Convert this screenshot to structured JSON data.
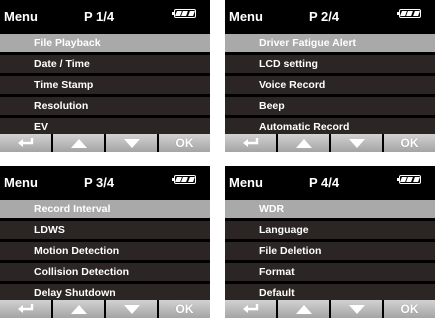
{
  "panels": [
    {
      "menu_title": "Menu",
      "page": "P 1/4",
      "items": [
        "File Playback",
        "Date / Time",
        "Time Stamp",
        "Resolution",
        "EV"
      ],
      "selected_index": 0
    },
    {
      "menu_title": "Menu",
      "page": "P 2/4",
      "items": [
        "Driver Fatigue Alert",
        "LCD setting",
        "Voice Record",
        "Beep",
        "Automatic Record"
      ],
      "selected_index": 0
    },
    {
      "menu_title": "Menu",
      "page": "P 3/4",
      "items": [
        "Record Interval",
        "LDWS",
        "Motion Detection",
        "Collision Detection",
        "Delay Shutdown"
      ],
      "selected_index": 0
    },
    {
      "menu_title": "Menu",
      "page": "P 4/4",
      "items": [
        "WDR",
        "Language",
        "File Deletion",
        "Format",
        "Default"
      ],
      "selected_index": 0
    }
  ],
  "nav": {
    "back_icon": "return-arrow-icon",
    "up_icon": "triangle-up-icon",
    "down_icon": "triangle-down-icon",
    "ok_label": "OK"
  },
  "battery_level": "full",
  "colors": {
    "background": "#000000",
    "item": "#2b2623",
    "selected_item": "#a9a9a9",
    "nav_button": "#b8b8b8"
  }
}
